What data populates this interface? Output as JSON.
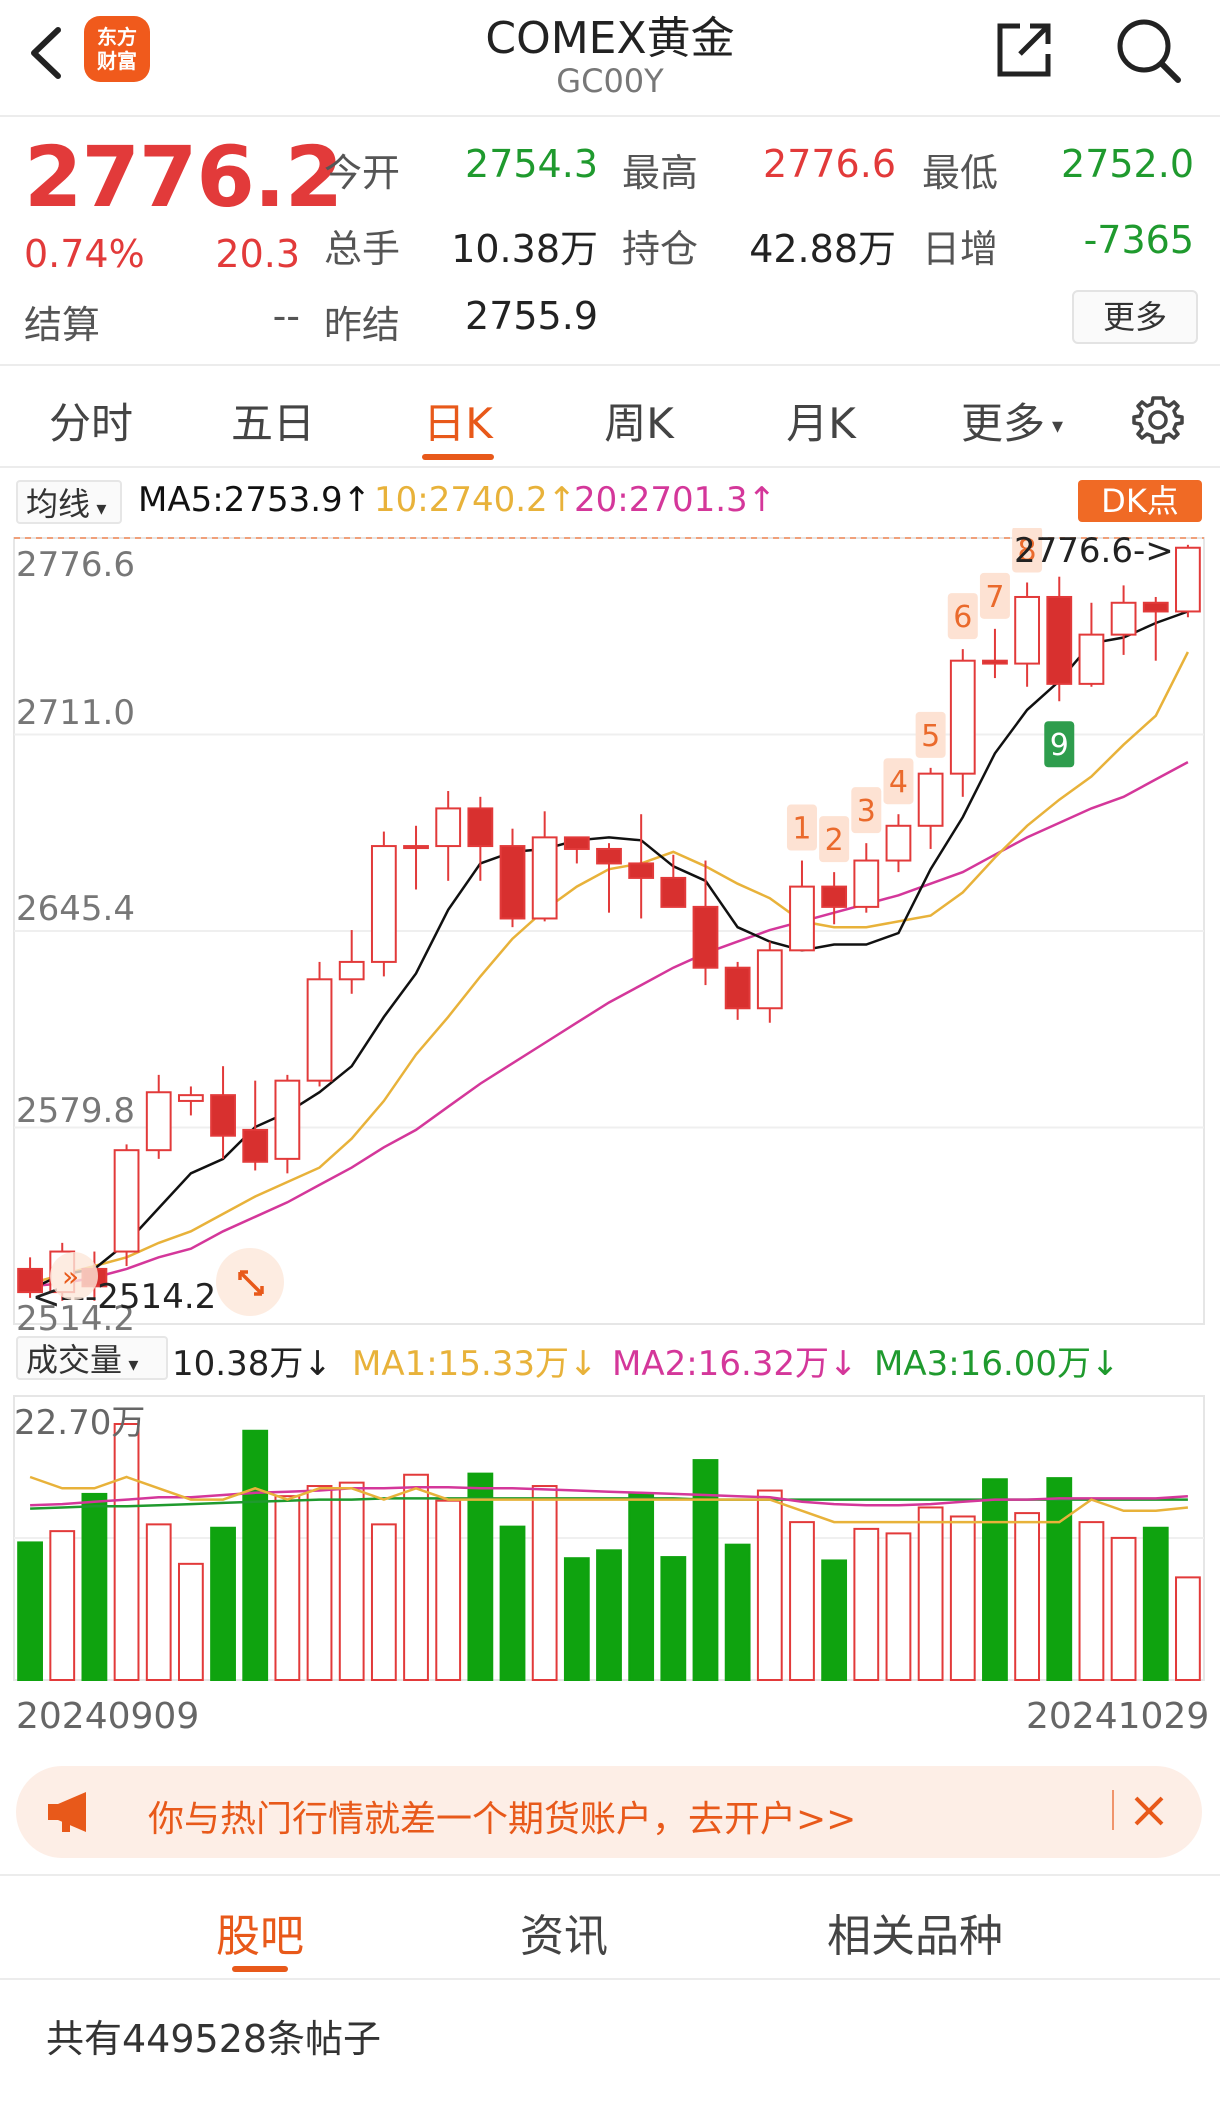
{
  "header": {
    "title": "COMEX黄金",
    "code": "GC00Y",
    "logo_line1": "东方",
    "logo_line2": "财富",
    "icons": {
      "back": "chevron-left-icon",
      "share": "share-icon",
      "search": "search-icon"
    }
  },
  "quote": {
    "price": "2776.2",
    "change_pct": "0.74%",
    "change": "20.3",
    "settle_label": "结算",
    "settle_value": "--",
    "fields": [
      {
        "label": "今开",
        "value": "2754.3",
        "color": "green"
      },
      {
        "label": "最高",
        "value": "2776.6",
        "color": "red"
      },
      {
        "label": "最低",
        "value": "2752.0",
        "color": "green"
      },
      {
        "label": "总手",
        "value": "10.38万",
        "color": "dark"
      },
      {
        "label": "持仓",
        "value": "42.88万",
        "color": "dark"
      },
      {
        "label": "日增",
        "value": "-7365",
        "color": "green"
      },
      {
        "label": "昨结",
        "value": "2755.9",
        "color": "dark"
      }
    ],
    "more_label": "更多"
  },
  "tabs": {
    "items": [
      "分时",
      "五日",
      "日K",
      "周K",
      "月K",
      "更多"
    ],
    "active": "日K"
  },
  "ma_legend": {
    "dropdown": "均线",
    "ma5": "MA5:2753.9↑",
    "ma10": "10:2740.2↑",
    "ma20": "20:2701.3↑",
    "dk_label": "DK点"
  },
  "volume_legend": {
    "dropdown": "成交量",
    "vol": "10.38万↓",
    "ma1": "MA1:15.33万↓",
    "ma2": "MA2:16.32万↓",
    "ma3": "MA3:16.00万↓"
  },
  "colors": {
    "up": "#e23a3a",
    "down": "#1f9a2e",
    "ma5": "#111111",
    "ma10": "#e8b23a",
    "ma20": "#d4379a",
    "accent": "#e8591a"
  },
  "chart_data": {
    "type": "candlestick",
    "y_ticks": [
      "2776.6",
      "2711.0",
      "2645.4",
      "2579.8",
      "2514.2"
    ],
    "ylim": [
      2514.2,
      2776.6
    ],
    "high_marker": "2776.6->",
    "low_marker": "<---2514.2",
    "vol_tick": "22.70万",
    "dates": {
      "start": "20240909",
      "end": "20241029"
    },
    "candles": [
      [
        2527,
        2519,
        2531,
        2517
      ],
      [
        2519,
        2533,
        2536,
        2516
      ],
      [
        2527,
        2521,
        2533,
        2516
      ],
      [
        2533,
        2568,
        2570,
        2528
      ],
      [
        2568,
        2588,
        2594,
        2565
      ],
      [
        2585,
        2587,
        2590,
        2580
      ],
      [
        2587,
        2573,
        2597,
        2565
      ],
      [
        2575,
        2564,
        2592,
        2561
      ],
      [
        2565,
        2592,
        2594,
        2560
      ],
      [
        2592,
        2627,
        2633,
        2590
      ],
      [
        2627,
        2633,
        2644,
        2622
      ],
      [
        2633,
        2673,
        2678,
        2628
      ],
      [
        2673,
        2673,
        2680,
        2658
      ],
      [
        2673,
        2686,
        2692,
        2661
      ],
      [
        2686,
        2673,
        2690,
        2661
      ],
      [
        2673,
        2648,
        2679,
        2645
      ],
      [
        2648,
        2676,
        2685,
        2647
      ],
      [
        2676,
        2672,
        2676,
        2667
      ],
      [
        2672,
        2667,
        2674,
        2650
      ],
      [
        2667,
        2662,
        2684,
        2648
      ],
      [
        2662,
        2652,
        2670,
        2652
      ],
      [
        2652,
        2631,
        2668,
        2625
      ],
      [
        2631,
        2617,
        2633,
        2613
      ],
      [
        2617,
        2637,
        2640,
        2612
      ],
      [
        2637,
        2659,
        2668,
        2637
      ],
      [
        2659,
        2652,
        2664,
        2646
      ],
      [
        2652,
        2668,
        2674,
        2650
      ],
      [
        2668,
        2680,
        2684,
        2664
      ],
      [
        2680,
        2698,
        2700,
        2672
      ],
      [
        2698,
        2737,
        2741,
        2690
      ],
      [
        2737,
        2736,
        2748,
        2731
      ],
      [
        2736,
        2759,
        2764,
        2728
      ],
      [
        2759,
        2729,
        2766,
        2723
      ],
      [
        2729,
        2746,
        2757,
        2728
      ],
      [
        2746,
        2757,
        2763,
        2739
      ],
      [
        2757,
        2754,
        2759,
        2737
      ],
      [
        2754,
        2776,
        2777,
        2752
      ]
    ],
    "ma5": [
      2520,
      2525,
      2527,
      2536,
      2548,
      2560,
      2565,
      2576,
      2581,
      2588,
      2597,
      2614,
      2629,
      2651,
      2667,
      2671,
      2672,
      2675,
      2676,
      2675,
      2666,
      2661,
      2645,
      2640,
      2637,
      2639,
      2639,
      2643,
      2665,
      2683,
      2705,
      2720,
      2730,
      2743,
      2745,
      2750,
      2754
    ],
    "ma10": [
      2522,
      2525,
      2528,
      2531,
      2536,
      2540,
      2546,
      2552,
      2557,
      2562,
      2572,
      2585,
      2601,
      2614,
      2628,
      2641,
      2651,
      2659,
      2665,
      2667,
      2671,
      2666,
      2660,
      2655,
      2647,
      2645,
      2645,
      2647,
      2649,
      2657,
      2669,
      2680,
      2689,
      2697,
      2708,
      2718,
      2740
    ],
    "ma20": [
      2521,
      2522,
      2524,
      2527,
      2531,
      2534,
      2540,
      2545,
      2550,
      2556,
      2562,
      2569,
      2575,
      2583,
      2591,
      2598,
      2605,
      2612,
      2619,
      2625,
      2631,
      2636,
      2640,
      2644,
      2647,
      2650,
      2653,
      2656,
      2660,
      2664,
      2670,
      2676,
      2681,
      2686,
      2690,
      2696,
      2702
    ],
    "volume": [
      12.2,
      13.2,
      16.5,
      22.7,
      13.8,
      10.3,
      13.5,
      22.1,
      16.3,
      17.2,
      17.5,
      13.8,
      18.2,
      15.9,
      18.3,
      13.6,
      17.2,
      10.8,
      11.5,
      16.5,
      10.9,
      19.5,
      12.0,
      16.8,
      14.0,
      10.6,
      13.4,
      13.0,
      15.3,
      14.5,
      17.8,
      14.8,
      17.9,
      14.0,
      12.6,
      13.5,
      9.1
    ],
    "vol_ma1": [
      18,
      17,
      17,
      18,
      17,
      16,
      16,
      17,
      16,
      17,
      17,
      16,
      17,
      16,
      16,
      16,
      16,
      16,
      16,
      16,
      16,
      16,
      16,
      16,
      15,
      14,
      14,
      14,
      14,
      14,
      14,
      14,
      14,
      16,
      15,
      15,
      15.3
    ],
    "vol_ma2": [
      15.5,
      15.6,
      15.8,
      16,
      16.2,
      16.2,
      16.4,
      16.6,
      16.7,
      16.8,
      17,
      17,
      17.1,
      17.1,
      17,
      17,
      16.9,
      16.8,
      16.7,
      16.6,
      16.5,
      16.4,
      16.3,
      16.2,
      15.8,
      15.6,
      15.5,
      15.5,
      15.6,
      15.8,
      16,
      16,
      16.1,
      16.1,
      16.1,
      16.1,
      16.3
    ],
    "vol_ma3": [
      15.2,
      15.3,
      15.4,
      15.4,
      15.5,
      15.6,
      15.7,
      15.8,
      15.9,
      16,
      16,
      16.1,
      16.1,
      16.1,
      16.1,
      16.1,
      16.1,
      16.1,
      16.1,
      16.1,
      16.1,
      16,
      16,
      16,
      16,
      16,
      16,
      16,
      16,
      16,
      16,
      16,
      16,
      16,
      16,
      16,
      16.0
    ],
    "td_count_labels": [
      {
        "index": 24,
        "label": "1"
      },
      {
        "index": 25,
        "label": "2"
      },
      {
        "index": 26,
        "label": "3"
      },
      {
        "index": 27,
        "label": "4"
      },
      {
        "index": 28,
        "label": "5"
      },
      {
        "index": 29,
        "label": "6"
      },
      {
        "index": 30,
        "label": "7"
      },
      {
        "index": 31,
        "label": "8"
      },
      {
        "index": 32,
        "label": "9"
      }
    ]
  },
  "banner": {
    "text": "你与热门行情就差一个期货账户，去开户>>",
    "icons": {
      "left": "megaphone-icon",
      "close": "close-icon"
    }
  },
  "bottom_tabs": {
    "items": [
      "股吧",
      "资讯",
      "相关品种"
    ],
    "active": "股吧"
  },
  "post_count": "共有449528条帖子"
}
